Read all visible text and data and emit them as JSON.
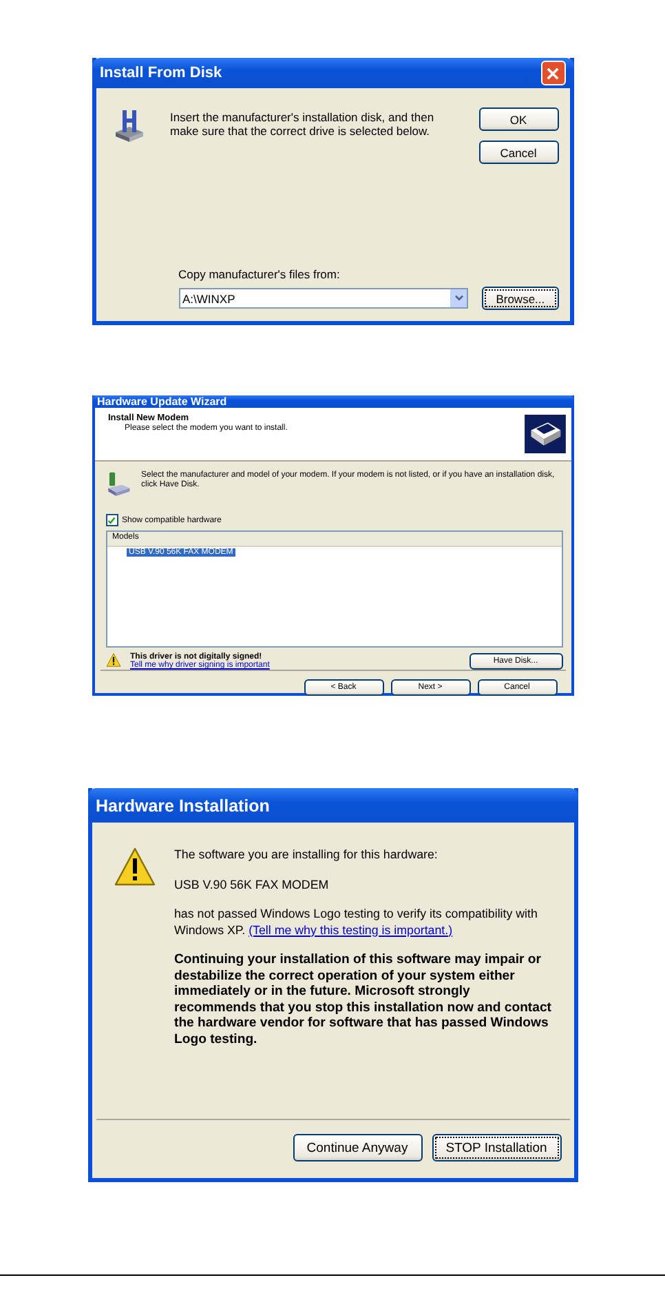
{
  "dialogs": [
    {
      "kind": "install_from_disk",
      "title": "Install From Disk",
      "message": "Insert the manufacturer's installation disk, and then make sure that the correct drive is selected below.",
      "buttons": [
        {
          "label": "OK",
          "focused": false
        },
        {
          "label": "Cancel",
          "focused": false
        }
      ],
      "copy_label": "Copy manufacturer's files from:",
      "path": "A:\\WINXP",
      "browse": {
        "label": "Browse...",
        "focused": true
      }
    },
    {
      "kind": "wizard",
      "title": "Hardware Update Wizard",
      "header_title": "Install New Modem",
      "header_subtitle": "Please select the modem you want to install.",
      "message": "Select the manufacturer and model of your modem. If your modem is not listed, or if you have an installation disk, click Have Disk.",
      "show_compatible": {
        "label": "Show compatible hardware",
        "checked": true
      },
      "list_header": "Models",
      "models": [
        {
          "label": "USB V.90 56K FAX MODEM",
          "selected": true
        }
      ],
      "warning": "This driver is not digitally signed!",
      "warning_link": "Tell me why driver signing is important",
      "have_disk": {
        "label": "Have Disk...",
        "focused": false
      },
      "nav_buttons": [
        {
          "label": "< Back",
          "focused": false
        },
        {
          "label": "Next >",
          "focused": false
        },
        {
          "label": "Cancel",
          "focused": false
        }
      ]
    },
    {
      "kind": "logo_warning",
      "title": "Hardware Installation",
      "intro": "The software you are installing for this hardware:",
      "device": "USB V.90 56K FAX MODEM",
      "notice": "has not passed Windows Logo testing to verify its compatibility with Windows XP.",
      "notice_link": "(Tell me why this testing is important.)",
      "caution": "Continuing your installation of this software may impair or destabilize the correct operation of your system either immediately or in the future. Microsoft strongly recommends that you stop this installation now and contact the hardware vendor for software that has passed Windows Logo testing.",
      "buttons": [
        {
          "label": "Continue Anyway",
          "focused": false
        },
        {
          "label": "STOP Installation",
          "focused": true
        }
      ]
    }
  ]
}
